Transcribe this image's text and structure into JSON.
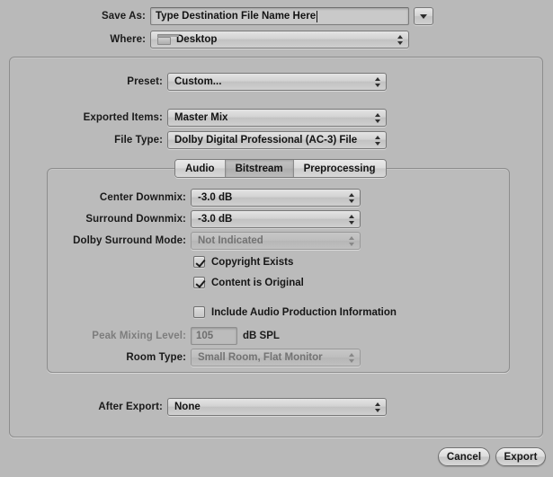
{
  "dialog": {
    "save_as": {
      "label": "Save As:",
      "value": "Type Destination File Name Here",
      "placeholder": "Type Destination File Name Here",
      "disclosure_icon": "chevron-down-icon"
    },
    "where": {
      "label": "Where:",
      "value": "Desktop",
      "icon": "folder-icon"
    },
    "preset": {
      "label": "Preset:",
      "value": "Custom..."
    },
    "exported_items": {
      "label": "Exported Items:",
      "value": "Master Mix"
    },
    "file_type": {
      "label": "File Type:",
      "value": "Dolby Digital Professional (AC-3) File"
    },
    "tabs": [
      {
        "label": "Audio",
        "selected": false
      },
      {
        "label": "Bitstream",
        "selected": true
      },
      {
        "label": "Preprocessing",
        "selected": false
      }
    ],
    "bitstream": {
      "center_downmix": {
        "label": "Center Downmix:",
        "value": "-3.0 dB",
        "disabled": false
      },
      "surround_downmix": {
        "label": "Surround Downmix:",
        "value": "-3.0 dB",
        "disabled": false
      },
      "dolby_surround_mode": {
        "label": "Dolby Surround Mode:",
        "value": "Not Indicated",
        "disabled": true
      },
      "copyright_exists": {
        "label": "Copyright Exists",
        "checked": true
      },
      "content_is_original": {
        "label": "Content is Original",
        "checked": true
      },
      "include_audio_production_information": {
        "label": "Include Audio Production Information",
        "checked": false
      },
      "peak_mixing_level": {
        "label": "Peak Mixing Level:",
        "value": "105",
        "suffix": "dB SPL",
        "disabled": true
      },
      "room_type": {
        "label": "Room Type:",
        "value": "Small Room, Flat Monitor",
        "disabled": true
      }
    },
    "after_export": {
      "label": "After Export:",
      "value": "None"
    },
    "buttons": {
      "cancel": "Cancel",
      "export": "Export"
    },
    "colors": {
      "window_background": "#b9b9b9",
      "control_face": "#d6d6d6",
      "border": "#7b7b7b",
      "text": "#161616",
      "disabled_text": "#737373"
    }
  }
}
